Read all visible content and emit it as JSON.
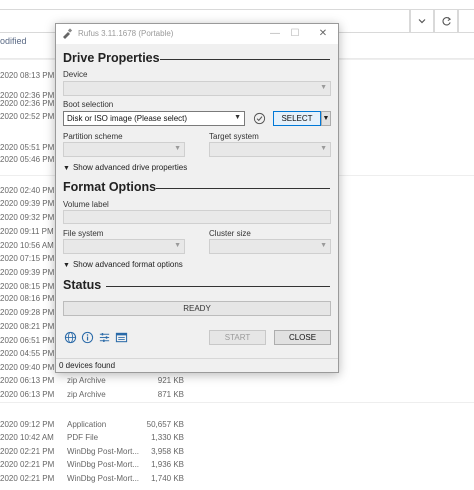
{
  "explorer": {
    "column_header": "odified",
    "refresh_icon": "refresh-icon",
    "dropdown_icon": "chevron-down-icon",
    "rows": [
      {
        "date": "2020 08:13 PM",
        "type": "",
        "size": ""
      },
      {
        "date": "2020 02:36 PM",
        "type": "",
        "size": ""
      },
      {
        "date": "2020 02:36 PM",
        "type": "",
        "size": ""
      },
      {
        "date": "2020 02:52 PM",
        "type": "",
        "size": ""
      },
      {
        "date": "2020 05:51 PM",
        "type": "",
        "size": ""
      },
      {
        "date": "2020 05:46 PM",
        "type": "",
        "size": ""
      },
      {
        "date": "2020 02:40 PM",
        "type": "",
        "size": ""
      },
      {
        "date": "2020 09:39 PM",
        "type": "",
        "size": ""
      },
      {
        "date": "2020 09:32 PM",
        "type": "",
        "size": ""
      },
      {
        "date": "2020 09:11 PM",
        "type": "",
        "size": ""
      },
      {
        "date": "2020 10:56 AM",
        "type": "",
        "size": ""
      },
      {
        "date": "2020 07:15 PM",
        "type": "",
        "size": ""
      },
      {
        "date": "2020 09:39 PM",
        "type": "",
        "size": ""
      },
      {
        "date": "2020 08:15 PM",
        "type": "",
        "size": ""
      },
      {
        "date": "2020 08:16 PM",
        "type": "",
        "size": ""
      },
      {
        "date": "2020 09:28 PM",
        "type": "",
        "size": ""
      },
      {
        "date": "2020 08:21 PM",
        "type": "",
        "size": ""
      },
      {
        "date": "2020 06:51 PM",
        "type": "",
        "size": ""
      },
      {
        "date": "2020 04:55 PM",
        "type": "",
        "size": ""
      },
      {
        "date": "2020 09:40 PM",
        "type": "",
        "size": ""
      },
      {
        "date": "2020 06:13 PM",
        "type": "zip Archive",
        "size": "921 KB"
      },
      {
        "date": "2020 06:13 PM",
        "type": "zip Archive",
        "size": "871 KB"
      },
      {
        "date": "2020 09:12 PM",
        "type": "Application",
        "size": "50,657 KB"
      },
      {
        "date": "2020 10:42 AM",
        "type": "PDF File",
        "size": "1,330 KB"
      },
      {
        "date": "2020 02:21 PM",
        "type": "WinDbg Post-Mort...",
        "size": "3,958 KB"
      },
      {
        "date": "2020 02:21 PM",
        "type": "WinDbg Post-Mort...",
        "size": "1,936 KB"
      },
      {
        "date": "2020 02:21 PM",
        "type": "WinDbg Post-Mort...",
        "size": "1,740 KB"
      }
    ]
  },
  "rufus": {
    "title": "Rufus 3.11.1678 (Portable)",
    "titlebar_buttons": {
      "minimize": "—",
      "maximize": "☐",
      "close": "✕"
    },
    "drive_properties": {
      "heading": "Drive Properties",
      "device_label": "Device",
      "device_value": "",
      "boot_selection_label": "Boot selection",
      "boot_selection_value": "Disk or ISO image (Please select)",
      "select_button": "SELECT",
      "partition_scheme_label": "Partition scheme",
      "target_system_label": "Target system",
      "advanced_toggle": "Show advanced drive properties"
    },
    "format_options": {
      "heading": "Format Options",
      "volume_label_label": "Volume label",
      "volume_label_value": "",
      "file_system_label": "File system",
      "cluster_size_label": "Cluster size",
      "advanced_toggle": "Show advanced format options"
    },
    "status": {
      "heading": "Status",
      "progress_text": "READY",
      "progress_fraction": 0
    },
    "toolbar_icons": [
      "globe-icon",
      "info-icon",
      "settings-sliders-icon",
      "log-icon"
    ],
    "start_button": "START",
    "close_button": "CLOSE",
    "statusbar_text": "0 devices found",
    "colors": {
      "accent": "#0078d7",
      "window_bg": "#f0f0f0"
    }
  }
}
